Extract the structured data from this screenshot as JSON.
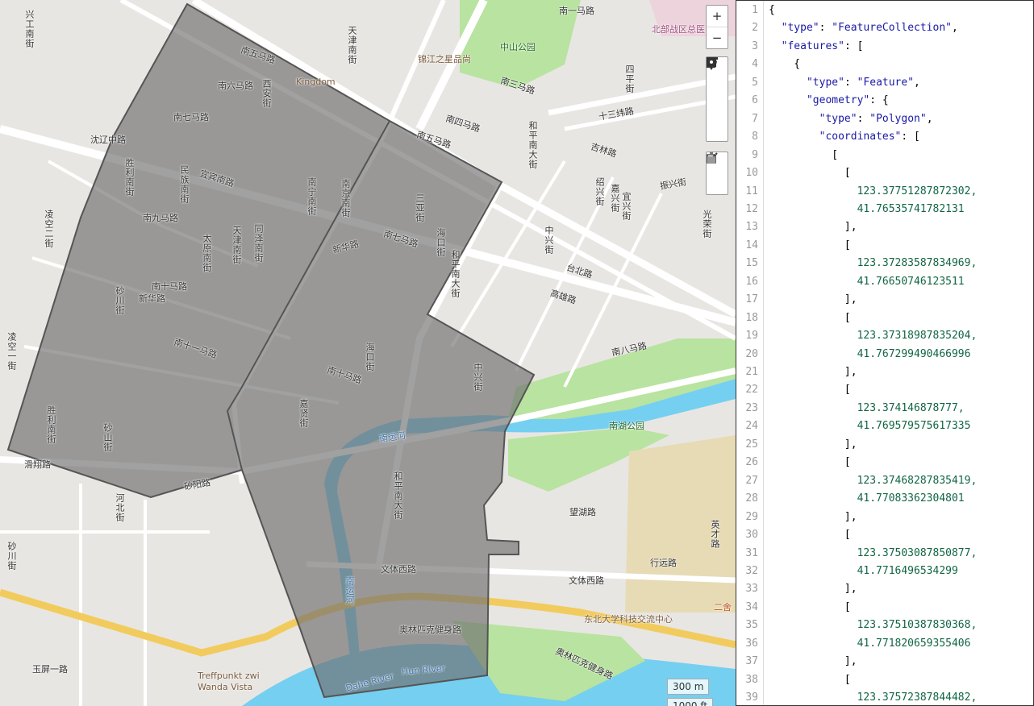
{
  "map": {
    "controls": {
      "zoom_in": "+",
      "zoom_out": "−"
    },
    "draw_tools": [
      "line-icon",
      "polygon-icon",
      "rectangle-icon",
      "marker-icon"
    ],
    "edit_tools": [
      "edit-icon",
      "trash-icon"
    ],
    "scale": {
      "metric": "300 m",
      "imperial": "1000 ft"
    },
    "polygon_fill": "#6e6e6e",
    "labels": {
      "l1": "南五马路",
      "l2": "南六马路",
      "l3": "南七马路",
      "l4": "沈辽中路",
      "l5": "胜利南街",
      "l6": "民族南街",
      "l7": "宜宾南路",
      "l8": "南九马路",
      "l9": "太原南街",
      "l10": "天津南街",
      "l11": "同泽南街",
      "l12": "南十马路",
      "l13": "新华路",
      "l14": "砂川街",
      "l15": "南十一马路",
      "l16": "胜利南街",
      "l17": "砂山街",
      "l18": "砂阳路",
      "l19": "滑翔路",
      "l20": "凌空二街",
      "l21": "南宁南街",
      "l22": "南京南街",
      "l23": "三亚街",
      "l24": "海口街",
      "l25": "南七马路",
      "l26": "和平南大街",
      "l27": "新华路",
      "l28": "南十马路",
      "l29": "海口街",
      "l30": "嘉贤街",
      "l31": "南运河",
      "l32": "南运河",
      "l33": "和平南大街",
      "l34": "文体西路",
      "l35": "文体西路",
      "l36": "奥林匹克健身路",
      "l37": "奥林匹克健身路",
      "l38": "Dahe River",
      "l39": "Hun River",
      "l40": "Treffpunkt zwi\nWanda Vista",
      "l41": "南八马路",
      "l42": "南湖公园",
      "l43": "望湖路",
      "l44": "行远路",
      "l45": "东北大学科技交流中心",
      "l46": "英才路",
      "l47": "中山公园",
      "l48": "锦江之星品尚",
      "l49": "Kingdom",
      "l50": "北部战区总医",
      "l51": "南三马路",
      "l52": "南四马路",
      "l53": "十三纬路",
      "l54": "吉林路",
      "l55": "四平街",
      "l56": "和平南大街",
      "l57": "中兴街",
      "l58": "台北路",
      "l59": "高雄路",
      "l60": "光荣街",
      "l61": "振兴街",
      "l62": "中兴街",
      "l63": "南一马路",
      "l64": "兴工南街",
      "l65": "河北街",
      "l66": "砂川街",
      "l67": "玉屏一路",
      "l68": "二舍",
      "l69": "天津南街",
      "l70": "西安街",
      "l71": "凌空一街",
      "l72": "南五马路",
      "l73": "绍兴街",
      "l74": "嘉兴街",
      "l75": "宜兴街"
    }
  },
  "editor": {
    "lines": [
      "{",
      "  \"type\": \"FeatureCollection\",",
      "  \"features\": [",
      "    {",
      "      \"type\": \"Feature\",",
      "      \"geometry\": {",
      "        \"type\": \"Polygon\",",
      "        \"coordinates\": [",
      "          [",
      "            [",
      "              123.37751287872302,",
      "              41.76535741782131",
      "            ],",
      "            [",
      "              123.37283587834969,",
      "              41.76650746123511",
      "            ],",
      "            [",
      "              123.37318987835204,",
      "              41.767299490466996",
      "            ],",
      "            [",
      "              123.374146878777,",
      "              41.769579575617335",
      "            ],",
      "            [",
      "              123.37468287835419,",
      "              41.77083362304801",
      "            ],",
      "            [",
      "              123.37503087850877,",
      "              41.7716496534299",
      "            ],",
      "            [",
      "              123.37510387830368,",
      "              41.771820659355406",
      "            ],",
      "            [",
      "              123.37572387844482,"
    ]
  }
}
